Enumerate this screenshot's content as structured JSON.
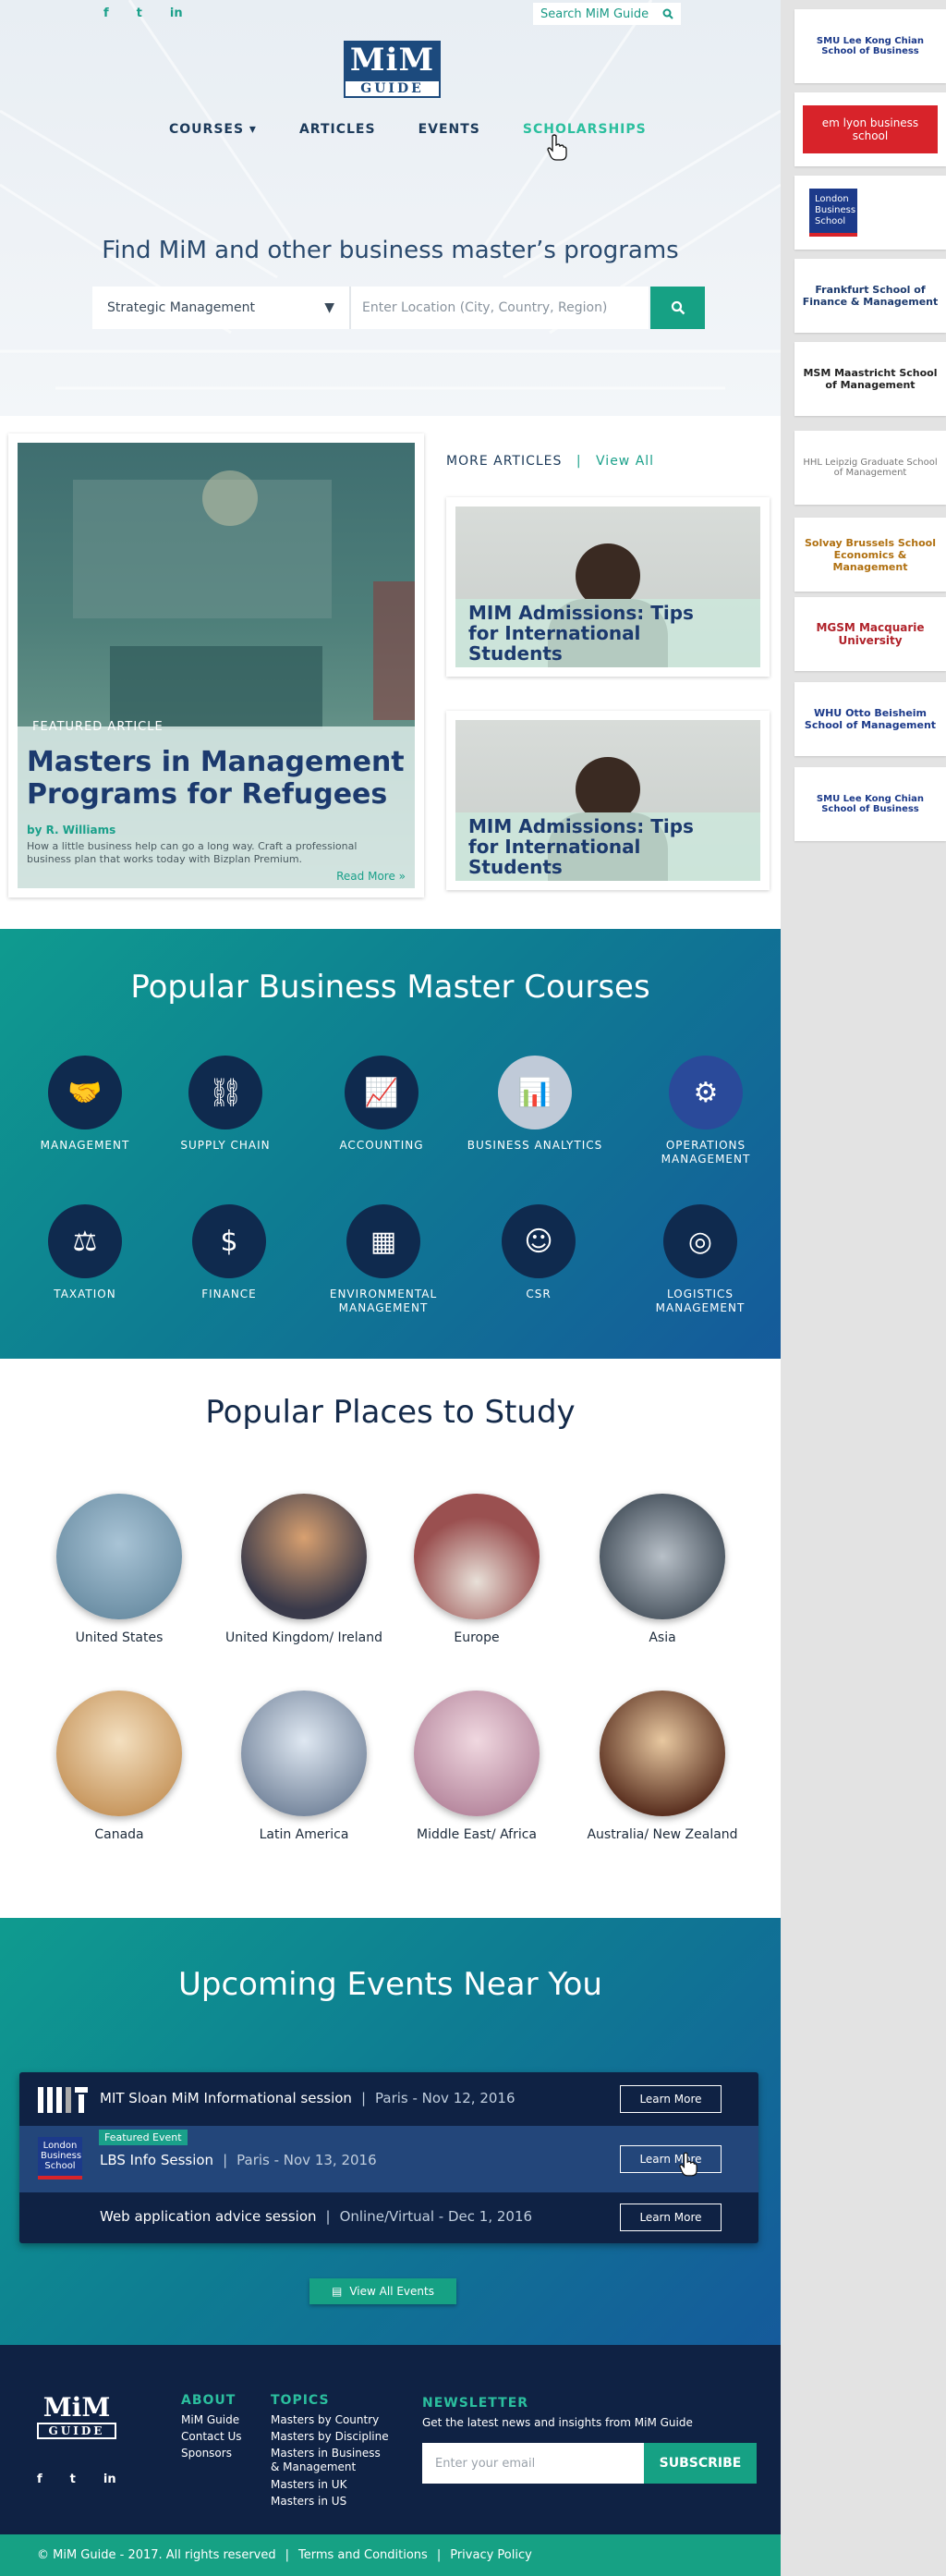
{
  "header": {
    "social": [
      "f",
      "t",
      "in"
    ],
    "search_label": "Search MiM Guide",
    "logo_top": "MiM",
    "logo_bottom": "GUIDE",
    "nav": [
      "COURSES ▾",
      "ARTICLES",
      "EVENTS",
      "SCHOLARSHIPS"
    ]
  },
  "hero": {
    "title": "Find MiM and other business master’s programs",
    "discipline_value": "Strategic Management",
    "location_placeholder": "Enter Location (City, Country, Region)"
  },
  "featured": {
    "tag": "FEATURED ARTICLE",
    "title": "Masters in Management Programs for Refugees",
    "byline": "by R. Williams",
    "description": "How a little business help can go a long way. Craft a professional business plan that works today with Bizplan Premium.",
    "read_more": "Read More »"
  },
  "more_articles": {
    "label": "MORE ARTICLES",
    "separator": "|",
    "view_all": "View All",
    "items": [
      {
        "title": "MIM Admissions: Tips for International Students"
      },
      {
        "title": "MIM Admissions: Tips for International Students"
      }
    ]
  },
  "courses": {
    "title": "Popular Business Master Courses",
    "items": [
      {
        "label": "MANAGEMENT",
        "icon": "handshake-icon"
      },
      {
        "label": "SUPPLY CHAIN",
        "icon": "network-icon"
      },
      {
        "label": "ACCOUNTING",
        "icon": "chart-icon"
      },
      {
        "label": "BUSINESS ANALYTICS",
        "icon": "analytics-icon"
      },
      {
        "label": "OPERATIONS MANAGEMENT",
        "icon": "gears-icon"
      },
      {
        "label": "TAXATION",
        "icon": "tax-icon"
      },
      {
        "label": "FINANCE",
        "icon": "coins-icon"
      },
      {
        "label": "ENVIRONMENTAL MANAGEMENT",
        "icon": "presentation-icon"
      },
      {
        "label": "CSR",
        "icon": "people-icon"
      },
      {
        "label": "LOGISTICS MANAGEMENT",
        "icon": "globe-icon"
      }
    ]
  },
  "places": {
    "title": "Popular Places to Study",
    "items": [
      {
        "label": "United States",
        "color": "#7fa3b8"
      },
      {
        "label": "United Kingdom/ Ireland",
        "color": "#5a5a6a"
      },
      {
        "label": "Europe",
        "color": "#8a5a5a"
      },
      {
        "label": "Asia",
        "color": "#7a8590"
      },
      {
        "label": "Canada",
        "color": "#d8b58a"
      },
      {
        "label": "Latin America",
        "color": "#8aa0b8"
      },
      {
        "label": "Middle East/ Africa",
        "color": "#c89aa8"
      },
      {
        "label": "Australia/ New Zealand",
        "color": "#7a5040"
      }
    ]
  },
  "events": {
    "title": "Upcoming Events Near You",
    "featured_label": "Featured Event",
    "items": [
      {
        "logo": "MIT",
        "name": "MIT Sloan MiM Informational session",
        "meta": "Paris - Nov 12, 2016",
        "button": "Learn More"
      },
      {
        "logo": "London Business School",
        "name": "LBS Info Session",
        "meta": "Paris - Nov 13, 2016",
        "button": "Learn More"
      },
      {
        "logo": "",
        "name": "Web application advice session",
        "meta": "Online/Virtual - Dec 1, 2016",
        "button": "Learn More"
      }
    ],
    "view_all": "View All Events"
  },
  "footer": {
    "logo_top": "MiM",
    "logo_bottom": "GUIDE",
    "about_title": "ABOUT",
    "about_links": [
      "MiM Guide",
      "Contact Us",
      "Sponsors"
    ],
    "topics_title": "TOPICS",
    "topics_links": [
      "Masters by Country",
      "Masters by Discipline",
      "Masters in Business & Management",
      "Masters in UK",
      "Masters in US"
    ],
    "newsletter_title": "NEWSLETTER",
    "newsletter_text": "Get the latest news and insights from MiM Guide",
    "email_placeholder": "Enter your email",
    "subscribe": "SUBSCRIBE",
    "copyright": "© MiM Guide - 2017. All rights reserved",
    "terms": "Terms and Conditions",
    "privacy": "Privacy Policy"
  },
  "sidebar": {
    "schools": [
      {
        "name": "SMU Lee Kong Chian School of Business",
        "color": "#1c3a8a"
      },
      {
        "name": "em lyon business school",
        "color": "#d8232a"
      },
      {
        "name": "London Business School",
        "color": "#1c3a8a"
      },
      {
        "name": "Frankfurt School of Finance & Management",
        "color": "#1c3a6e"
      },
      {
        "name": "MSM Maastricht School of Management",
        "color": "#222222"
      },
      {
        "name": "HHL Leipzig Graduate School of Management",
        "color": "#8a8a8a"
      },
      {
        "name": "Solvay Brussels School Economics & Management",
        "color": "#e8a020"
      },
      {
        "name": "MGSM Macquarie University",
        "color": "#b0222a"
      },
      {
        "name": "WHU Otto Beisheim School of Management",
        "color": "#1c3a8a"
      },
      {
        "name": "SMU Lee Kong Chian School of Business",
        "color": "#1c3a8a"
      }
    ]
  }
}
